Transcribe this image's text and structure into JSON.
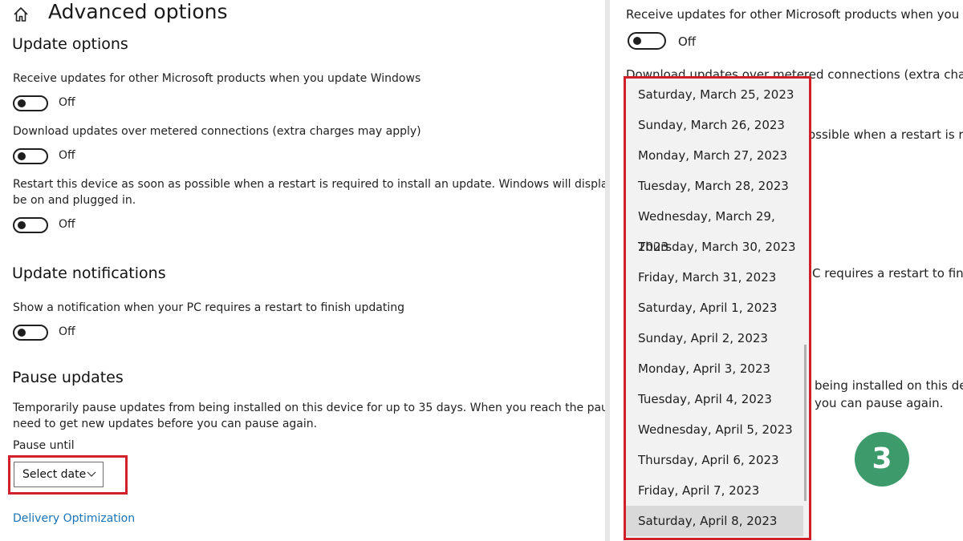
{
  "left": {
    "title": "Advanced options",
    "update_options": {
      "heading": "Update options",
      "items": [
        {
          "label": "Receive updates for other Microsoft products when you update Windows",
          "state": "Off"
        },
        {
          "label": "Download updates over metered connections (extra charges may apply)",
          "state": "Off"
        },
        {
          "label_line1": "Restart this device as soon as possible when a restart is required to install an update. Windows will display a notice b",
          "label_line2": "be on and plugged in.",
          "state": "Off"
        }
      ]
    },
    "update_notifications": {
      "heading": "Update notifications",
      "label": "Show a notification when your PC requires a restart to finish updating",
      "state": "Off"
    },
    "pause_updates": {
      "heading": "Pause updates",
      "desc_line1": "Temporarily pause updates from being installed on this device for up to 35 days. When you reach the pause limit, yo",
      "desc_line2": "need to get new updates before you can pause again.",
      "pause_until_label": "Pause until",
      "select_value": "Select date"
    },
    "link": "Delivery Optimization"
  },
  "right": {
    "bg_receive_label": "Receive updates for other Microsoft products when you up",
    "bg_receive_state": "Off",
    "bg_download_label": "Download updates over metered connections (extra charge",
    "bg_restart_fragment": "ossible when a restart is req",
    "bg_notify_fragment": "C requires a restart to finis",
    "bg_pause_fragment1": "being installed on this dev",
    "bg_pause_fragment2": "you can pause again.",
    "dropdown": {
      "options": [
        "Saturday, March 25, 2023",
        "Sunday, March 26, 2023",
        "Monday, March 27, 2023",
        "Tuesday, March 28, 2023",
        "Wednesday, March 29, 2023",
        "Thursday, March 30, 2023",
        "Friday, March 31, 2023",
        "Saturday, April 1, 2023",
        "Sunday, April 2, 2023",
        "Monday, April 3, 2023",
        "Tuesday, April 4, 2023",
        "Wednesday, April 5, 2023",
        "Thursday, April 6, 2023",
        "Friday, April 7, 2023",
        "Saturday, April 8, 2023"
      ],
      "highlighted": "Saturday, April 8, 2023"
    },
    "step_badge": "3"
  },
  "colors": {
    "highlight_frame": "#d0212b",
    "badge": "#3c9a6b",
    "link": "#1a73b8"
  },
  "icons": [
    "home-icon",
    "chevron-down-icon"
  ]
}
